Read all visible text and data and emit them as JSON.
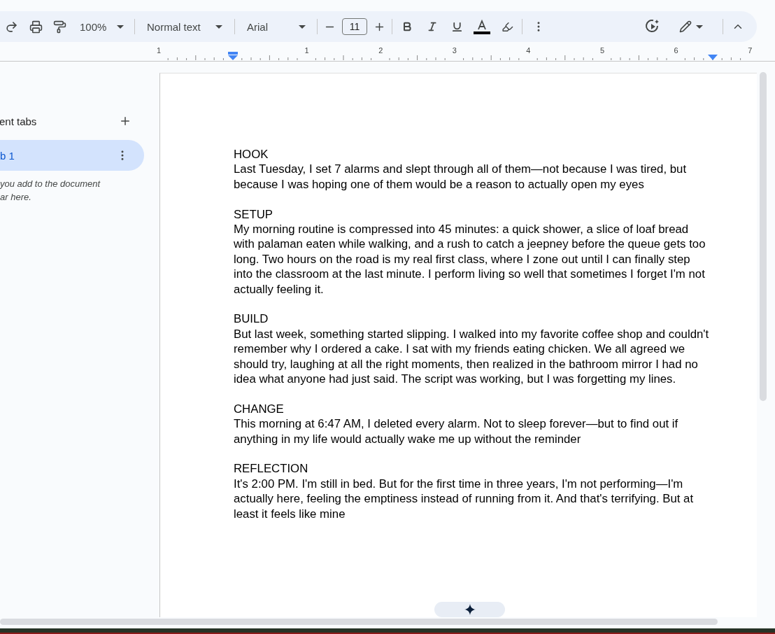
{
  "toolbar": {
    "zoom": "100%",
    "style": "Normal text",
    "font": "Arial",
    "font_size": "11"
  },
  "ruler": {
    "labels": [
      "1",
      "1",
      "2",
      "3",
      "4",
      "5",
      "6",
      "7"
    ]
  },
  "sidebar": {
    "title": "ent tabs",
    "tabs": [
      {
        "label": "b 1",
        "selected": true
      }
    ],
    "hint": [
      "you add to the document",
      "ar here."
    ]
  },
  "document": {
    "sections": [
      {
        "heading": "HOOK",
        "body": "Last Tuesday, I set 7 alarms and slept through all of them—not because I was tired, but because I was hoping one of them would be a reason to actually open my eyes"
      },
      {
        "heading": "SETUP",
        "body": "My morning routine is compressed into 45 minutes: a quick shower, a slice of loaf bread with palaman eaten while walking, and a rush to catch a jeepney before the queue gets too long. Two hours on the road is my real first class, where I zone out until I can finally step into the classroom at the last minute. I perform living so well that sometimes I forget I'm not actually feeling it."
      },
      {
        "heading": "BUILD",
        "body": "But last week, something started slipping. I walked into my favorite coffee shop and couldn't remember why I ordered a cake. I sat with my friends eating chicken. We all agreed we should try, laughing at all the right moments, then realized in the bathroom mirror I had no idea what anyone had just said. The script was working, but I was forgetting my lines."
      },
      {
        "heading": "CHANGE",
        "body": "This morning at 6:47 AM, I deleted every alarm. Not to sleep forever—but to find out if anything in my life would actually wake me up without the reminder"
      },
      {
        "heading": "REFLECTION",
        "body": "It's 2:00 PM. I'm still in bed. But for the first time in three years, I'm not performing—I'm actually here, feeling the emptiness instead of running from it. And that's terrifying. But at least it feels like mine"
      }
    ]
  }
}
